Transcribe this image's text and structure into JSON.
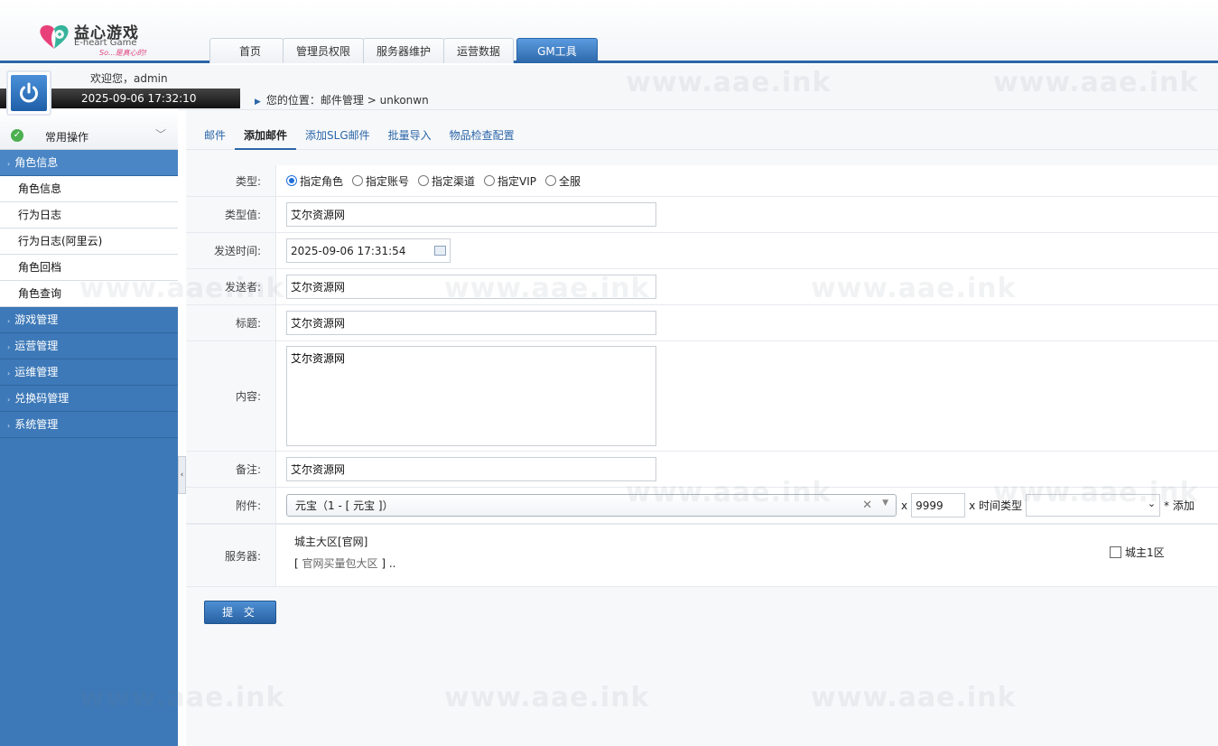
{
  "header": {
    "brand_cn": "益心游戏",
    "brand_en": "E-heart Game",
    "brand_slogan": "So...是真心的!",
    "nav_tabs": [
      {
        "label": "首页"
      },
      {
        "label": "管理员权限"
      },
      {
        "label": "服务器维护"
      },
      {
        "label": "运营数据"
      },
      {
        "label": "GM工具",
        "active": true
      }
    ]
  },
  "user": {
    "welcome": "欢迎您，admin",
    "datetime": "2025-09-06 17:32:10"
  },
  "location": {
    "text": "您的位置：邮件管理 > unkonwn"
  },
  "sidebar": {
    "header": "常用操作",
    "groups": [
      {
        "label": "角色信息",
        "open": true,
        "items": [
          "角色信息",
          "行为日志",
          "行为日志(阿里云)",
          "角色回档",
          "角色查询"
        ]
      },
      {
        "label": "游戏管理"
      },
      {
        "label": "运营管理"
      },
      {
        "label": "运维管理"
      },
      {
        "label": "兑换码管理"
      },
      {
        "label": "系统管理"
      }
    ]
  },
  "subtabs": [
    {
      "label": "邮件"
    },
    {
      "label": "添加邮件",
      "active": true
    },
    {
      "label": "添加SLG邮件"
    },
    {
      "label": "批量导入"
    },
    {
      "label": "物品检查配置"
    }
  ],
  "form": {
    "type_label": "类型:",
    "type_options": [
      "指定角色",
      "指定账号",
      "指定渠道",
      "指定VIP",
      "全服"
    ],
    "type_selected": "指定角色",
    "type_value_label": "类型值:",
    "type_value": "艾尔资源网",
    "send_time_label": "发送时间:",
    "send_time": "2025-09-06 17:31:54",
    "sender_label": "发送者:",
    "sender": "艾尔资源网",
    "title_label": "标题:",
    "title": "艾尔资源网",
    "content_label": "内容:",
    "content": "艾尔资源网",
    "remark_label": "备注:",
    "remark": "艾尔资源网",
    "attachment_label": "附件:",
    "attachment_item": "元宝（1 - [ 元宝 ]）",
    "attachment_x1": "x",
    "attachment_qty": "9999",
    "attachment_x2": "x 时间类型",
    "attachment_add": "* 添加",
    "server_label": "服务器:",
    "server_zone": "城主大区[官网]",
    "server_bracket_open": "[",
    "server_subzone": "官网买量包大区",
    "server_bracket_close": "] ..",
    "server_checkbox": "城主1区",
    "submit": "提 交"
  },
  "watermark": "www.aae.ink"
}
